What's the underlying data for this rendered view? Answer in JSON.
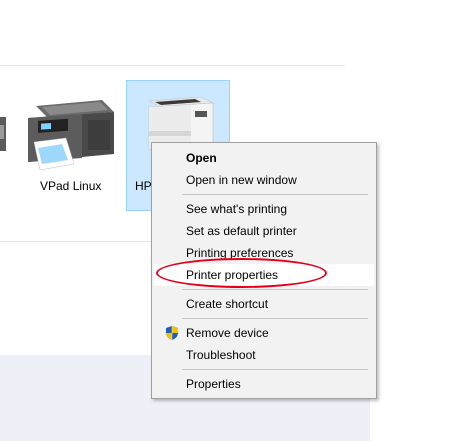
{
  "devices": [
    {
      "label": "VPad Linux",
      "icon": "multifunction-printer-icon",
      "selected": false
    },
    {
      "label": "HP",
      "icon": "laser-printer-icon",
      "selected": true
    }
  ],
  "context_menu": {
    "items": [
      {
        "label": "Open",
        "bold": true
      },
      {
        "label": "Open in new window"
      },
      {
        "label": "See what's printing"
      },
      {
        "label": "Set as default printer"
      },
      {
        "label": "Printing preferences"
      },
      {
        "label": "Printer properties",
        "highlighted": true
      },
      {
        "label": "Create shortcut"
      },
      {
        "label": "Remove device",
        "icon": "uac-shield-icon"
      },
      {
        "label": "Troubleshoot"
      },
      {
        "label": "Properties"
      }
    ]
  },
  "annotation": {
    "color": "#e2001a",
    "marks": "printer-properties-item"
  },
  "colors": {
    "selection": "#cce8ff",
    "selection_border": "#99d1ff",
    "menu_bg": "#f2f2f2"
  }
}
